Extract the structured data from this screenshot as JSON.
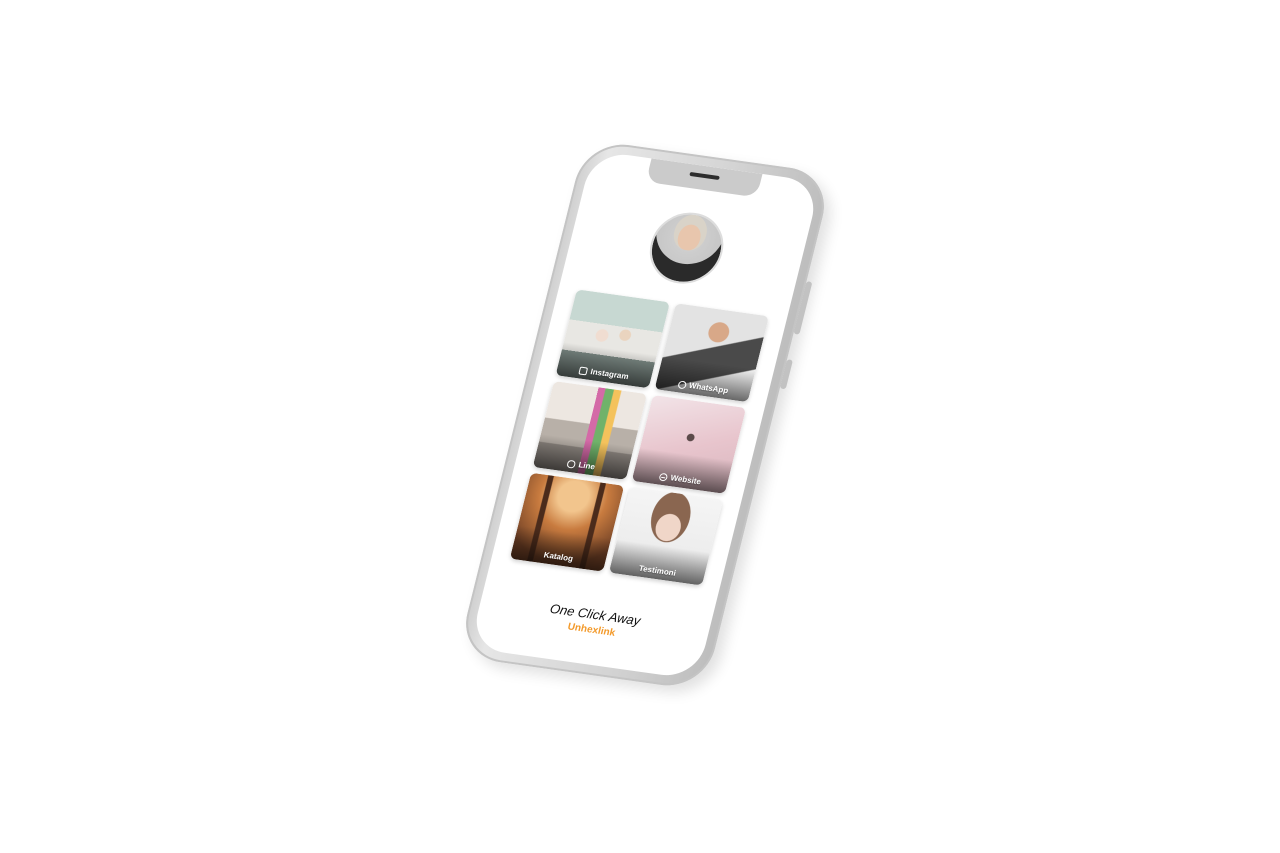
{
  "profile": {
    "avatar_icon": "avatar"
  },
  "tiles": [
    {
      "label": "Instagram",
      "icon": "instagram-icon"
    },
    {
      "label": "WhatsApp",
      "icon": "whatsapp-icon"
    },
    {
      "label": "Line",
      "icon": "line-icon"
    },
    {
      "label": "Website",
      "icon": "website-icon"
    },
    {
      "label": "Katalog",
      "icon": ""
    },
    {
      "label": "Testimoni",
      "icon": ""
    }
  ],
  "footer": {
    "tagline": "One Click Away",
    "brand": "Unhexlink",
    "brand_color": "#f39a2b"
  }
}
